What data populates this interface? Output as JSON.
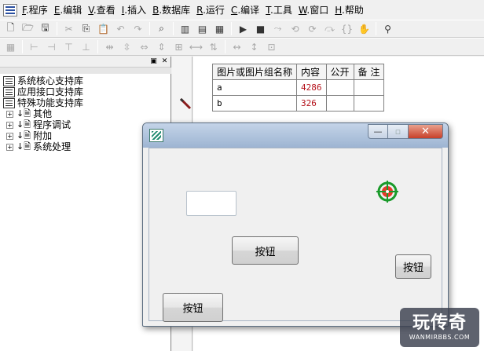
{
  "menu": [
    {
      "hot": "F",
      "label": ".程序"
    },
    {
      "hot": "E",
      "label": ".编辑"
    },
    {
      "hot": "V",
      "label": ".查看"
    },
    {
      "hot": "I",
      "label": ".插入"
    },
    {
      "hot": "B",
      "label": ".数据库"
    },
    {
      "hot": "R",
      "label": ".运行"
    },
    {
      "hot": "C",
      "label": ".编译"
    },
    {
      "hot": "T",
      "label": ".工具"
    },
    {
      "hot": "W",
      "label": ".窗口"
    },
    {
      "hot": "H",
      "label": ".帮助"
    }
  ],
  "toolbar1_icons": [
    "new-file-icon",
    "open-folder-icon",
    "save-icon",
    "cut-icon",
    "copy-icon",
    "paste-icon",
    "undo-icon",
    "redo-icon",
    "find-icon",
    "layout-a-icon",
    "layout-b-icon",
    "layout-c-icon",
    "run-icon",
    "stop-icon",
    "step-icon",
    "step-into-icon",
    "step-out-icon",
    "step-over-icon",
    "hand-icon",
    "binoculars-icon"
  ],
  "tree": {
    "libraries": [
      "系统核心支持库",
      "应用接口支持库",
      "特殊功能支持库"
    ],
    "folders": [
      "其他",
      "程序调试",
      "附加",
      "系统处理"
    ]
  },
  "table": {
    "headers": [
      "图片或图片组名称",
      "内容",
      "公开",
      "备 注"
    ],
    "rows": [
      {
        "name": "a",
        "content": "4286",
        "public": "",
        "note": ""
      },
      {
        "name": "b",
        "content": "326",
        "public": "",
        "note": ""
      }
    ]
  },
  "form": {
    "buttons": {
      "btn1": "按钮",
      "btn2": "按钮",
      "btn3": "按钮"
    },
    "controls": {
      "min": "—",
      "max": "▫",
      "close": "✕"
    }
  },
  "watermark": {
    "main": "玩传奇",
    "sub": "WANMIRBBS.COM"
  }
}
